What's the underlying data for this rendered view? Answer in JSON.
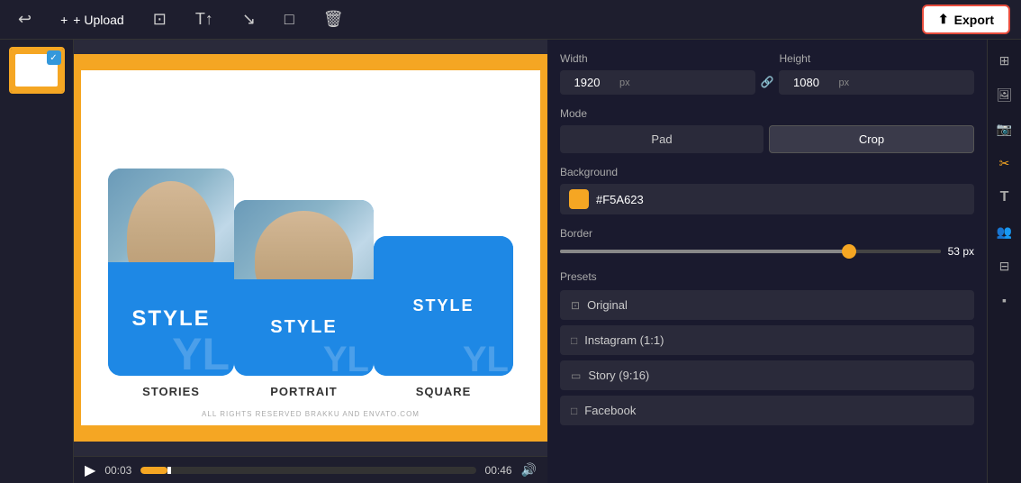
{
  "toolbar": {
    "upload_label": "+ Upload",
    "export_label": "Export"
  },
  "canvas": {
    "watermark": "ALL RIGHTS RESERVED BRAKKU AND ENVATO.COM",
    "cards": [
      {
        "label": "STORIES",
        "style_text": "STYLE"
      },
      {
        "label": "PORTRAIT",
        "style_text": "STYLE"
      },
      {
        "label": "SQUARE",
        "style_text": "STYLE"
      }
    ]
  },
  "timeline": {
    "current_time": "00:03",
    "end_time": "00:46"
  },
  "settings": {
    "width_label": "Width",
    "height_label": "Height",
    "width_value": "1920",
    "height_value": "1080",
    "px_label": "px",
    "mode_label": "Mode",
    "pad_label": "Pad",
    "crop_label": "Crop",
    "background_label": "Background",
    "bg_hex": "#F5A623",
    "border_label": "Border",
    "border_value": "53",
    "presets_label": "Presets",
    "preset_original": "Original",
    "preset_instagram": "Instagram (1:1)",
    "preset_story": "Story (9:16)",
    "preset_facebook": "Facebook"
  },
  "icons": {
    "grid": "⊞",
    "image": "🖼",
    "photo": "📷",
    "crop_active": "✂",
    "text": "T",
    "person_add": "👥",
    "sliders": "⊟",
    "layers": "▪"
  }
}
